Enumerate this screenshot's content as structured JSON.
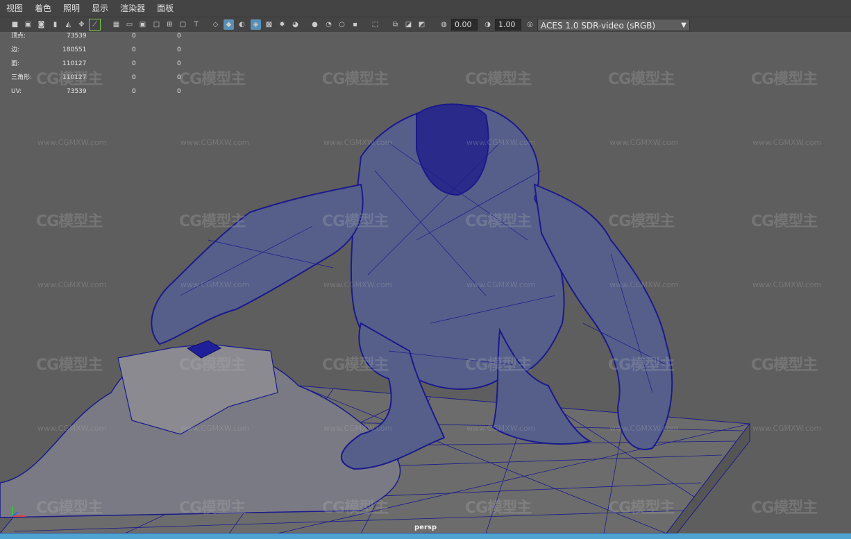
{
  "menu": [
    "视图",
    "着色",
    "照明",
    "显示",
    "渲染器",
    "面板"
  ],
  "toolbar": {
    "exposure": "0.00",
    "gamma": "1.00",
    "color_space": "ACES 1.0 SDR-video (sRGB)"
  },
  "hud": {
    "rows": [
      {
        "label": "顶点:",
        "total": "73539",
        "sel": "0",
        "comp": "0"
      },
      {
        "label": "边:",
        "total": "180551",
        "sel": "0",
        "comp": "0"
      },
      {
        "label": "面:",
        "total": "110127",
        "sel": "0",
        "comp": "0"
      },
      {
        "label": "三角形:",
        "total": "110127",
        "sel": "0",
        "comp": "0"
      },
      {
        "label": "UV:",
        "total": "73539",
        "sel": "0",
        "comp": "0"
      }
    ]
  },
  "watermark": {
    "logo": "CG模型主",
    "url": "www.CGMXW.com"
  },
  "camera_label": "persp",
  "colors": {
    "wire": "#1a1a8c",
    "viewport_bg": "#5e5e5e",
    "accent": "#4fa3d0"
  }
}
